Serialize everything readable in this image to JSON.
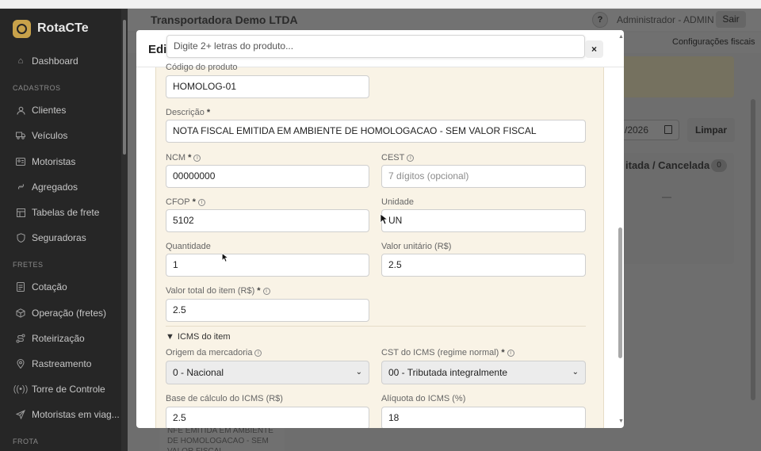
{
  "sidebar": {
    "brand": "RotaCTe",
    "items_top": [
      {
        "label": "Dashboard",
        "icon": "home-icon"
      }
    ],
    "sections": [
      {
        "title": "CADASTROS",
        "items": [
          {
            "label": "Clientes",
            "icon": "user-icon"
          },
          {
            "label": "Veículos",
            "icon": "truck-icon"
          },
          {
            "label": "Motoristas",
            "icon": "id-card-icon"
          },
          {
            "label": "Agregados",
            "icon": "link-icon"
          },
          {
            "label": "Tabelas de frete",
            "icon": "table-icon"
          },
          {
            "label": "Seguradoras",
            "icon": "shield-icon"
          }
        ]
      },
      {
        "title": "FRETES",
        "items": [
          {
            "label": "Cotação",
            "icon": "document-icon"
          },
          {
            "label": "Operação (fretes)",
            "icon": "box-icon"
          },
          {
            "label": "Roteirização",
            "icon": "route-icon"
          },
          {
            "label": "Rastreamento",
            "icon": "pin-icon"
          },
          {
            "label": "Torre de Controle",
            "icon": "broadcast-icon"
          },
          {
            "label": "Motoristas em viag...",
            "icon": "send-icon"
          }
        ]
      },
      {
        "title": "FROTA",
        "items": []
      }
    ]
  },
  "topbar": {
    "company": "Transportadora Demo LTDA",
    "help": "?",
    "user": "Administrador - ADMIN",
    "logout": "Sair"
  },
  "background": {
    "config_tab": "Configurações fiscais",
    "date_value": "/2026",
    "clear_button": "Limpar",
    "column_title": "itada / Cancelada",
    "column_count": "0",
    "column_dash": "—",
    "card_text": "NFE EMITIDA EM AMBIENTE DE HOMOLOGACAO - SEM VALOR FISCAL"
  },
  "modal": {
    "title": "Edi",
    "search_placeholder": "Digite 2+ letras do produto...",
    "close": "×",
    "fields": {
      "codigo_label": "Código do produto",
      "codigo_value": "HOMOLOG-01",
      "descricao_label": "Descrição",
      "descricao_value": "NOTA FISCAL EMITIDA EM AMBIENTE DE HOMOLOGACAO - SEM VALOR FISCAL",
      "ncm_label": "NCM",
      "ncm_value": "00000000",
      "cest_label": "CEST",
      "cest_placeholder": "7 dígitos (opcional)",
      "cfop_label": "CFOP",
      "cfop_value": "5102",
      "unidade_label": "Unidade",
      "unidade_value": "UN",
      "quantidade_label": "Quantidade",
      "quantidade_value": "1",
      "valor_unitario_label": "Valor unitário (R$)",
      "valor_unitario_value": "2.5",
      "valor_total_label": "Valor total do item (R$)",
      "valor_total_value": "2.5",
      "icms_section": "ICMS do item",
      "origem_label": "Origem da mercadoria",
      "origem_value": "0 - Nacional",
      "cst_label": "CST do ICMS (regime normal)",
      "cst_value": "00 - Tributada integralmente",
      "base_label": "Base de cálculo do ICMS (R$)",
      "base_value": "2.5",
      "aliquota_label": "Alíquota do ICMS (%)",
      "aliquota_value": "18"
    }
  },
  "colors": {
    "sidebar_bg": "#262626",
    "accent": "#c8a24a",
    "form_bg": "#f9f3e6"
  }
}
